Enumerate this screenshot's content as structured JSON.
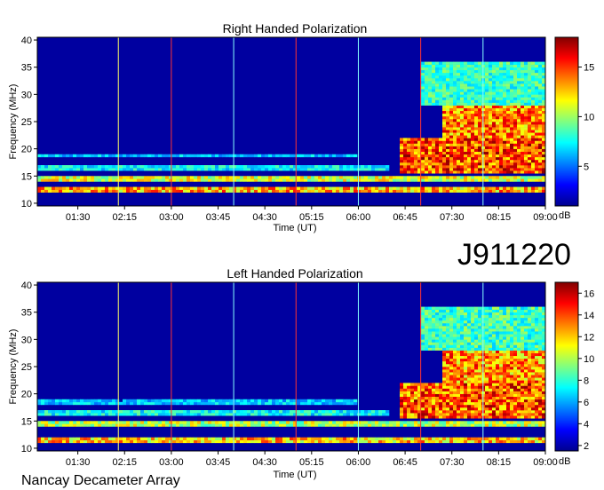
{
  "figure": {
    "observation_id": "J911220",
    "instrument_label": "Nancay Decameter Array"
  },
  "chart_data": [
    {
      "type": "heatmap",
      "title": "Right Handed Polarization",
      "xlabel": "Time (UT)",
      "ylabel": "Frequency (MHz)",
      "x_tick_labels": [
        "01:30",
        "02:15",
        "03:00",
        "03:45",
        "04:30",
        "05:15",
        "06:00",
        "06:45",
        "07:30",
        "08:15",
        "09:00"
      ],
      "x_range_utc_hours": [
        0.85,
        9.0
      ],
      "y_ticks": [
        10,
        15,
        20,
        25,
        30,
        35,
        40
      ],
      "y_range": [
        9.5,
        40.5
      ],
      "colorbar": {
        "label": "dB",
        "ticks": [
          5,
          10,
          15
        ],
        "range": [
          1,
          18
        ]
      },
      "reference_lines_utc": [
        {
          "time": "02:09",
          "color": "#ffff66"
        },
        {
          "time": "03:00",
          "color": "#ff3333"
        },
        {
          "time": "04:00",
          "color": "#88ffff"
        },
        {
          "time": "05:00",
          "color": "#ff3333"
        },
        {
          "time": "06:00",
          "color": "#88ffff"
        },
        {
          "time": "07:00",
          "color": "#ff3333"
        },
        {
          "time": "08:00",
          "color": "#88ffff"
        }
      ],
      "emission_bands_mhz": [
        {
          "start": "00:50",
          "end": "09:00",
          "freq": [
            11.8,
            13.2
          ],
          "intensity": 14
        },
        {
          "start": "00:50",
          "end": "09:00",
          "freq": [
            14.0,
            15.2
          ],
          "intensity": 12
        },
        {
          "start": "00:50",
          "end": "06:30",
          "freq": [
            16.2,
            17.0
          ],
          "intensity": 8
        },
        {
          "start": "00:50",
          "end": "06:00",
          "freq": [
            18.3,
            19.0
          ],
          "intensity": 7
        },
        {
          "start": "06:40",
          "end": "09:00",
          "freq": [
            15.5,
            22.0
          ],
          "intensity": 16
        },
        {
          "start": "07:20",
          "end": "09:00",
          "freq": [
            22.0,
            28.0
          ],
          "intensity": 15
        },
        {
          "start": "07:00",
          "end": "09:00",
          "freq": [
            28.0,
            36.0
          ],
          "intensity": 9
        }
      ]
    },
    {
      "type": "heatmap",
      "title": "Left Handed Polarization",
      "xlabel": "Time (UT)",
      "ylabel": "Frequency (MHz)",
      "x_tick_labels": [
        "01:30",
        "02:15",
        "03:00",
        "03:45",
        "04:30",
        "05:15",
        "06:00",
        "06:45",
        "07:30",
        "08:15",
        "09:00"
      ],
      "x_range_utc_hours": [
        0.85,
        9.0
      ],
      "y_ticks": [
        10,
        15,
        20,
        25,
        30,
        35,
        40
      ],
      "y_range": [
        9.5,
        40.5
      ],
      "colorbar": {
        "label": "dB",
        "ticks": [
          2,
          4,
          6,
          8,
          10,
          12,
          14,
          16
        ],
        "range": [
          1.5,
          17
        ]
      },
      "reference_lines_utc": [
        {
          "time": "02:09",
          "color": "#ffff66"
        },
        {
          "time": "03:00",
          "color": "#ff3333"
        },
        {
          "time": "04:00",
          "color": "#88ffff"
        },
        {
          "time": "05:00",
          "color": "#ff3333"
        },
        {
          "time": "06:00",
          "color": "#88ffff"
        },
        {
          "time": "07:00",
          "color": "#ff3333"
        },
        {
          "time": "08:00",
          "color": "#88ffff"
        }
      ],
      "emission_bands_mhz": [
        {
          "start": "00:50",
          "end": "09:00",
          "freq": [
            11.0,
            12.2
          ],
          "intensity": 13
        },
        {
          "start": "00:50",
          "end": "09:00",
          "freq": [
            13.8,
            14.8
          ],
          "intensity": 11
        },
        {
          "start": "00:50",
          "end": "06:30",
          "freq": [
            16.0,
            16.8
          ],
          "intensity": 8
        },
        {
          "start": "00:50",
          "end": "06:00",
          "freq": [
            18.0,
            18.8
          ],
          "intensity": 7
        },
        {
          "start": "06:40",
          "end": "09:00",
          "freq": [
            15.5,
            22.0
          ],
          "intensity": 15
        },
        {
          "start": "07:20",
          "end": "09:00",
          "freq": [
            22.0,
            28.0
          ],
          "intensity": 14
        },
        {
          "start": "07:00",
          "end": "09:00",
          "freq": [
            28.0,
            36.0
          ],
          "intensity": 9
        }
      ]
    }
  ]
}
